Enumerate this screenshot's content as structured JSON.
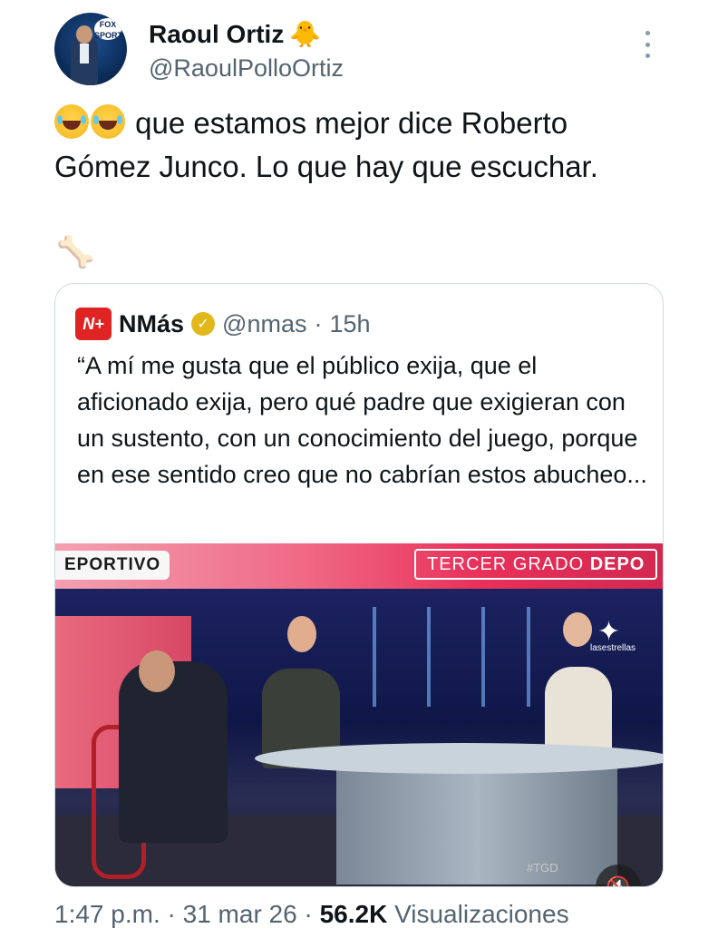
{
  "author": {
    "display_name": "Raoul Ortiz",
    "name_emoji": "🐥",
    "handle": "@RaoulPolloOrtiz",
    "avatar_logo_text": "FOX SPORTS"
  },
  "tweet": {
    "emojis": [
      "🤣",
      "🤣"
    ],
    "text_line_1": "que estamos mejor dice Roberto",
    "text_line_2": "Gómez Junco. Lo que hay que escuchar.",
    "trailing_emoji": "🦴"
  },
  "quoted": {
    "logo_text": "N+",
    "name": "NMás",
    "verified_icon": "check",
    "handle": "@nmas",
    "separator": "·",
    "age": "15h",
    "text": "“A mí me gusta que el público exija, que el aficionado exija, pero qué padre que exigieran con un sustento, con un conocimiento del juego, porque en ese sentido creo que no cabrían estos abucheo...",
    "video": {
      "banner_left": "EPORTIVO",
      "banner_right_prefix": "TERCER GRADO ",
      "banner_right_bold": "DEPO",
      "brand_small": "lasestrellas",
      "hashtag": "#TGD",
      "mute_icon": "muted-speaker"
    }
  },
  "footer": {
    "time": "1:47 p.m.",
    "sep": " · ",
    "date": "31 mar 26",
    "sep2": " · ",
    "views_count": "56.2K",
    "views_label": " Visualizaciones"
  },
  "colors": {
    "text": "#0f1419",
    "secondary": "#536471",
    "border": "#cfd9de",
    "nmas_red": "#e02424",
    "verified_gold": "#e2b719"
  }
}
